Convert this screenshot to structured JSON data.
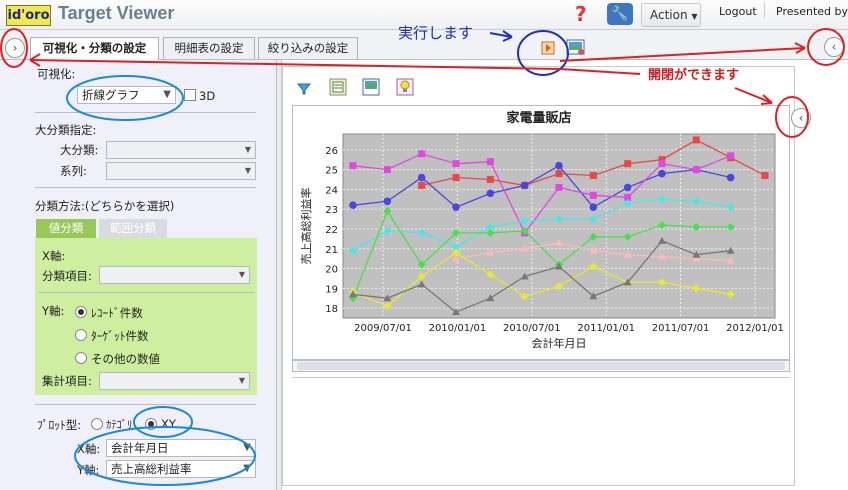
{
  "app": {
    "logo": "id'oro",
    "title": "Target Viewer",
    "action_label": "Action",
    "logout": "Logout",
    "presented_by": "Presented by"
  },
  "tabs": [
    {
      "label": "可視化・分類の設定",
      "active": true
    },
    {
      "label": "明細表の設定",
      "active": false
    },
    {
      "label": "絞り込みの設定",
      "active": false
    }
  ],
  "annotations": {
    "run": "実行します",
    "open_close": "開閉ができます"
  },
  "left": {
    "viz_label": "可視化:",
    "viz_value": "折線グラフ",
    "three_d_label": "3D",
    "major_heading": "大分類指定:",
    "major_label": "大分類:",
    "series_label": "系列:",
    "method_heading": "分類方法:(どちらかを選択)",
    "subtab_value": "値分類",
    "subtab_range": "範囲分類",
    "x_axis_heading": "X軸:",
    "x_item_label": "分類項目:",
    "y_axis_heading": "Y軸:",
    "y_opt1": "ﾚｺｰﾄﾞ件数",
    "y_opt2": "ﾀｰｹﾞｯﾄ件数",
    "y_opt3": "その他の数値",
    "agg_label": "集計項目:",
    "plot_type_label": "ﾌﾟﾛｯﾄ型:",
    "plot_opt_category": "ｶﾃｺﾞﾘ",
    "plot_opt_xy": "XY",
    "x_axis_label": "X軸:",
    "x_axis_value": "会計年月日",
    "y_axis_label": "Y軸:",
    "y_axis_value": "売上高総利益率"
  },
  "chart_data": {
    "type": "line",
    "title": "家電量販店",
    "xlabel": "会計年月日",
    "ylabel": "売上高総利益率",
    "ylim": [
      17.5,
      26.8
    ],
    "yticks": [
      18,
      19,
      20,
      21,
      22,
      23,
      24,
      25,
      26
    ],
    "xticks": [
      "2009/07/01",
      "2010/01/01",
      "2010/07/01",
      "2011/01/01",
      "2011/07/01",
      "2012/01/01"
    ],
    "x": [
      "2009/01",
      "2009/04",
      "2009/07",
      "2009/10",
      "2010/01",
      "2010/04",
      "2010/07",
      "2010/10",
      "2011/01",
      "2011/04",
      "2011/07",
      "2011/10",
      "2012/01"
    ],
    "grid": true,
    "series": [
      {
        "color": "#e84848",
        "marker": "square",
        "values": [
          null,
          null,
          24.2,
          24.6,
          24.5,
          24.2,
          24.8,
          24.7,
          25.3,
          25.5,
          26.5,
          25.6,
          24.7,
          24.4
        ]
      },
      {
        "color": "#4848e0",
        "marker": "circle",
        "values": [
          23.2,
          23.4,
          24.6,
          23.1,
          23.8,
          24.2,
          25.2,
          23.1,
          24.1,
          24.8,
          25.0,
          24.6
        ]
      },
      {
        "color": "#e048e0",
        "marker": "square",
        "values": [
          25.2,
          25.0,
          25.8,
          25.3,
          25.4,
          21.8,
          24.1,
          23.7,
          23.6,
          25.3,
          25.0,
          25.7
        ]
      },
      {
        "color": "#48e8e8",
        "marker": "diamond",
        "values": [
          20.9,
          21.9,
          21.8,
          21.1,
          22.1,
          22.4,
          22.5,
          22.5,
          23.3,
          23.5,
          23.4,
          23.1
        ]
      },
      {
        "color": "#48e048",
        "marker": "diamond",
        "values": [
          18.5,
          22.9,
          20.2,
          21.8,
          21.8,
          21.9,
          20.2,
          21.6,
          21.6,
          22.2,
          22.1,
          22.1
        ]
      },
      {
        "color": "#ffb8b8",
        "marker": "triangle",
        "values": [
          null,
          null,
          null,
          20.5,
          20.8,
          21.0,
          21.3,
          20.9,
          20.7,
          20.6,
          20.5,
          20.4
        ]
      },
      {
        "color": "#e8e830",
        "marker": "diamond",
        "values": [
          18.8,
          18.1,
          19.6,
          20.8,
          19.7,
          18.6,
          19.1,
          20.1,
          19.3,
          19.3,
          19.0,
          18.7
        ]
      },
      {
        "color": "#787878",
        "marker": "triangle",
        "values": [
          18.7,
          18.5,
          19.2,
          17.8,
          18.5,
          19.6,
          20.1,
          18.6,
          19.3,
          21.4,
          20.7,
          20.9
        ]
      }
    ]
  }
}
